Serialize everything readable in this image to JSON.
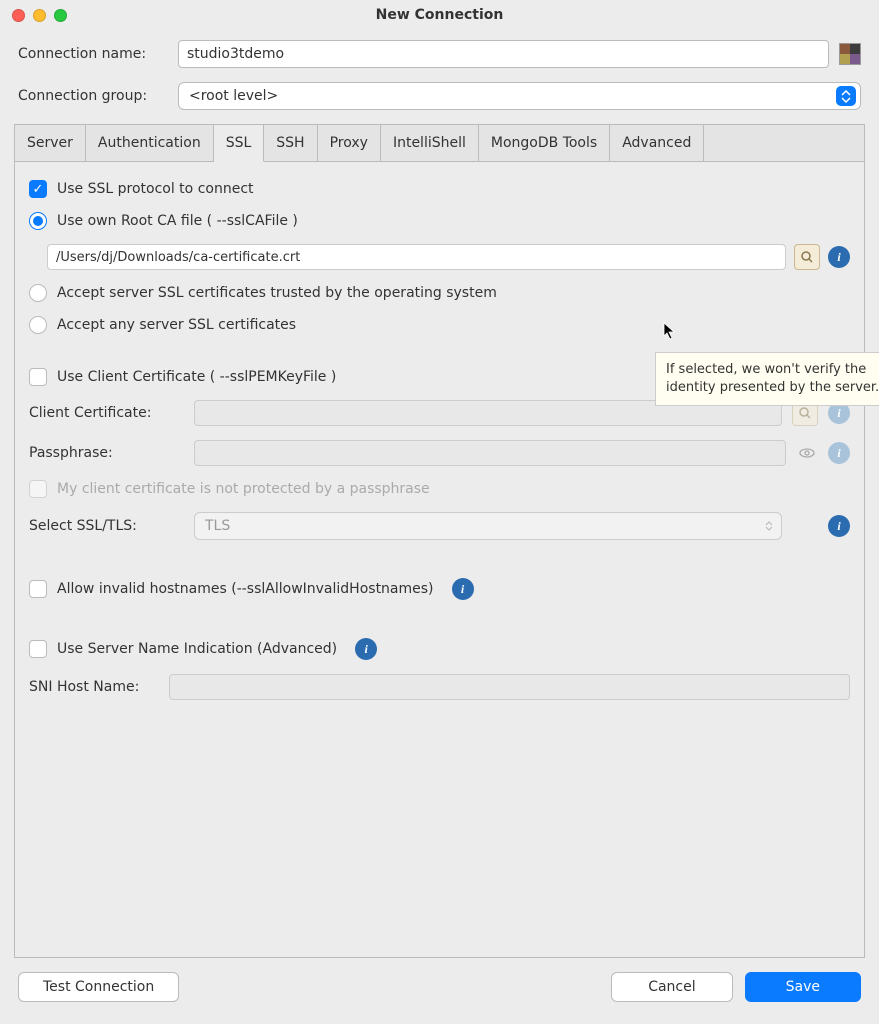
{
  "window": {
    "title": "New Connection"
  },
  "form": {
    "connection_name_label": "Connection name:",
    "connection_name_value": "studio3tdemo",
    "connection_group_label": "Connection group:",
    "connection_group_value": "<root level>"
  },
  "tabs": [
    {
      "label": "Server",
      "active": false
    },
    {
      "label": "Authentication",
      "active": false
    },
    {
      "label": "SSL",
      "active": true
    },
    {
      "label": "SSH",
      "active": false
    },
    {
      "label": "Proxy",
      "active": false
    },
    {
      "label": "IntelliShell",
      "active": false
    },
    {
      "label": "MongoDB Tools",
      "active": false
    },
    {
      "label": "Advanced",
      "active": false
    }
  ],
  "ssl": {
    "use_ssl_label": "Use SSL protocol to connect",
    "use_own_ca_label": "Use own Root CA file ( --sslCAFile )",
    "ca_file_path": "/Users/dj/Downloads/ca-certificate.crt",
    "accept_os_label": "Accept server SSL certificates trusted by the operating system",
    "accept_any_label": "Accept any server SSL certificates",
    "use_client_cert_label": "Use Client Certificate ( --sslPEMKeyFile )",
    "client_cert_label": "Client Certificate:",
    "passphrase_label": "Passphrase:",
    "no_passphrase_label": "My client certificate is not protected by a passphrase",
    "select_ssl_label": "Select SSL/TLS:",
    "select_ssl_value": "TLS",
    "allow_invalid_label": "Allow invalid hostnames (--sslAllowInvalidHostnames)",
    "use_sni_label": "Use Server Name Indication (Advanced)",
    "sni_host_label": "SNI Host Name:"
  },
  "tooltip": "If selected, we won't verify the identity presented by the server.",
  "footer": {
    "test_connection": "Test Connection",
    "cancel": "Cancel",
    "save": "Save"
  }
}
